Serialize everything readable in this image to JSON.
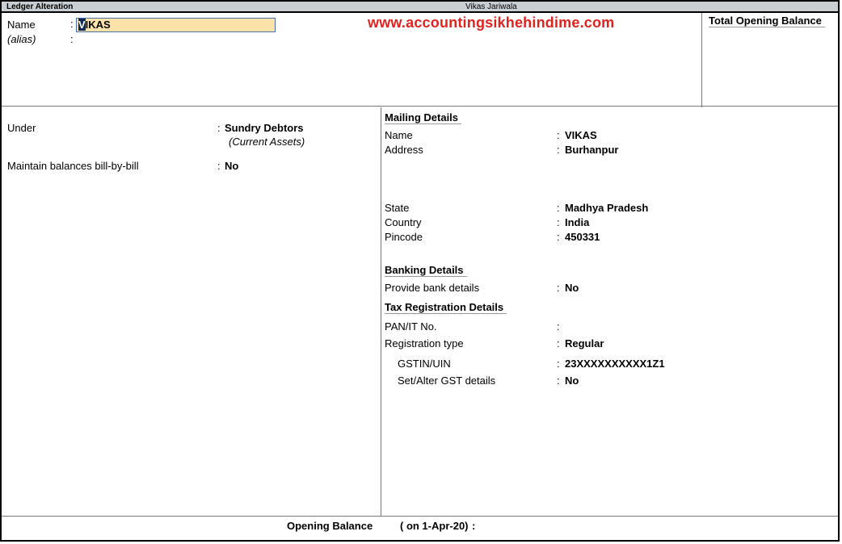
{
  "titlebar": {
    "left": "Ledger Alteration",
    "center": "Vikas Jariwala"
  },
  "watermark": "www.accountingsikhehindime.com",
  "header": {
    "name_label": "Name",
    "name_value_first": "V",
    "name_value_rest": "IKAS",
    "alias_label": "(alias)",
    "colon": ":"
  },
  "opening_panel": {
    "title": "Total Opening Balance"
  },
  "left": {
    "under_label": "Under",
    "under_value": "Sundry Debtors",
    "under_sub": "(Current Assets)",
    "bill_label": "Maintain balances bill-by-bill",
    "bill_value": "No"
  },
  "mailing": {
    "title": "Mailing Details",
    "name_label": "Name",
    "name_value": "VIKAS",
    "address_label": "Address",
    "address_value": "Burhanpur",
    "state_label": "State",
    "state_value": "Madhya Pradesh",
    "country_label": "Country",
    "country_value": "India",
    "pincode_label": "Pincode",
    "pincode_value": "450331"
  },
  "banking": {
    "title": "Banking Details",
    "bank_label": "Provide bank details",
    "bank_value": "No"
  },
  "tax": {
    "title": "Tax Registration Details",
    "pan_label": "PAN/IT No.",
    "regtype_label": "Registration type",
    "regtype_value": "Regular",
    "gstin_label": "GSTIN/UIN",
    "gstin_value": "23XXXXXXXXXX1Z1",
    "gst_alter_label": "Set/Alter GST details",
    "gst_alter_value": "No"
  },
  "footer": {
    "opening_label": "Opening Balance",
    "date_text": "( on 1-Apr-20)",
    "colon": ":"
  }
}
